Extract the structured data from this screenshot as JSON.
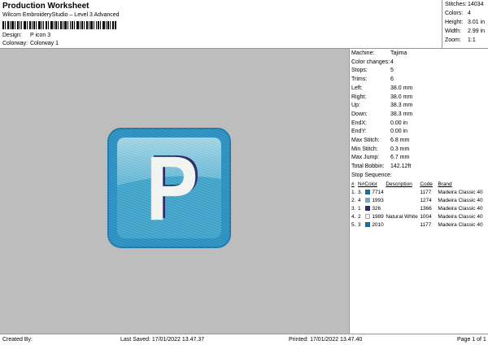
{
  "header": {
    "title": "Production Worksheet",
    "subtitle": "Wilcom EmbroideryStudio – Level 3 Advanced",
    "design_label": "Design:",
    "design_value": "P icon 3",
    "colorway_label": "Colorway:",
    "colorway_value": "Colorway 1"
  },
  "stats": [
    {
      "k": "Stitches:",
      "v": "14034"
    },
    {
      "k": "Colors:",
      "v": "4"
    },
    {
      "k": "Height:",
      "v": "3.01 in"
    },
    {
      "k": "Width:",
      "v": "2.99 in"
    },
    {
      "k": "Zoom:",
      "v": "1:1"
    }
  ],
  "info": [
    {
      "k": "Machine:",
      "v": "Tajima"
    },
    {
      "k": "Color changes:",
      "v": "4"
    },
    {
      "k": "Stops:",
      "v": "5"
    },
    {
      "k": "Trims:",
      "v": "6"
    },
    {
      "k": "Left:",
      "v": "38.0 mm"
    },
    {
      "k": "Right:",
      "v": "38.0 mm"
    },
    {
      "k": "Up:",
      "v": "38.3 mm"
    },
    {
      "k": "Down:",
      "v": "38.3 mm"
    },
    {
      "k": "EndX:",
      "v": "0.00 in"
    },
    {
      "k": "EndY:",
      "v": "0.00 in"
    },
    {
      "k": "Max Stitch:",
      "v": "6.8 mm"
    },
    {
      "k": "Min Stitch:",
      "v": "0.3 mm"
    },
    {
      "k": "Max Jump:",
      "v": "6.7 mm"
    },
    {
      "k": "Total Bobbin:",
      "v": "142.12ft"
    }
  ],
  "stop_sequence": {
    "title": "Stop Sequence:",
    "headers": [
      "#",
      "N#",
      "Color",
      "Description",
      "Code",
      "Brand"
    ],
    "rows": [
      {
        "num": "1.",
        "n": "3.",
        "color": "#1f6d9b",
        "code_name": "7714",
        "description": "",
        "code": "1177",
        "brand": "Madeira Classic 40"
      },
      {
        "num": "2.",
        "n": "4",
        "color": "#7fa6b8",
        "code_name": "1993",
        "description": "",
        "code": "1274",
        "brand": "Madeira Classic 40"
      },
      {
        "num": "3.",
        "n": "1",
        "color": "#2b2f6b",
        "code_name": "326",
        "description": "",
        "code": "1366",
        "brand": "Madeira Classic 40"
      },
      {
        "num": "4.",
        "n": "2",
        "color": "#f2f2f2",
        "code_name": "1989",
        "description": "Natural White",
        "code": "1004",
        "brand": "Madeira Classic 40"
      },
      {
        "num": "5.",
        "n": "3",
        "color": "#1f6d9b",
        "code_name": "2010",
        "description": "",
        "code": "1177",
        "brand": "Madeira Classic 40"
      }
    ]
  },
  "footer": {
    "created_by": "Created By:",
    "last_saved": "Last Saved: 17/01/2022 13.47.37",
    "printed": "Printed: 17/01/2022 13.47.40",
    "page": "Page 1 of 1"
  },
  "design": {
    "letter": "P",
    "outer_color": "#2a8fc0",
    "inner_color": "#3aa0c8",
    "accent_color": "#1a6e97",
    "letter_color": "#f1f4f1",
    "outline_color": "#2b2f6b"
  }
}
